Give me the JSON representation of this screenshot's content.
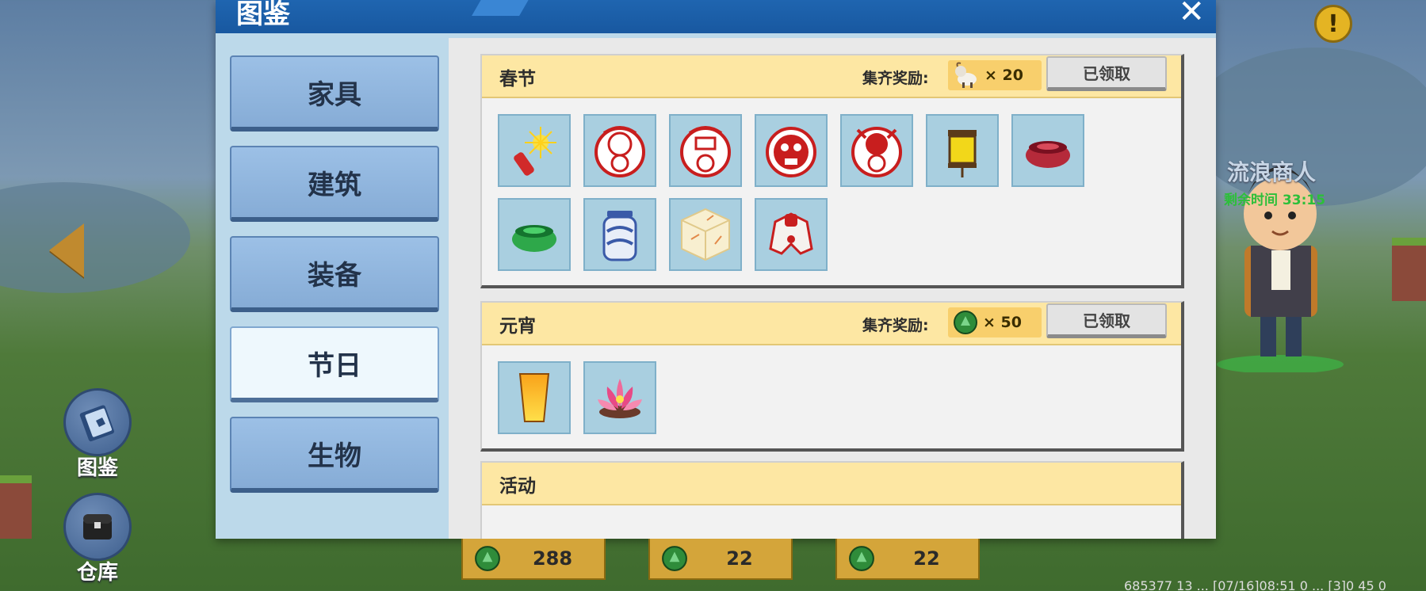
{
  "window": {
    "title": "图鉴",
    "close_label": "✕"
  },
  "categories": [
    {
      "label": "家具",
      "active": false
    },
    {
      "label": "建筑",
      "active": false
    },
    {
      "label": "装备",
      "active": false
    },
    {
      "label": "节日",
      "active": true
    },
    {
      "label": "生物",
      "active": false
    }
  ],
  "groups": [
    {
      "title": "春节",
      "reward_label": "集齐奖励:",
      "reward_icon": "goat-icon",
      "reward_amount": "× 20",
      "claim_label": "已领取",
      "items": [
        "firecracker-icon",
        "paper-cut-doll-fu-icon",
        "paper-cut-doll-lu-icon",
        "paper-cut-doll-shou-icon",
        "paper-cut-doll-xi-icon",
        "lantern-icon",
        "red-bowl-icon",
        "green-bowl-icon",
        "blue-vase-icon",
        "marble-cube-icon",
        "red-robe-icon"
      ]
    },
    {
      "title": "元宵",
      "reward_label": "集齐奖励:",
      "reward_icon": "green-gem-icon",
      "reward_amount": "× 50",
      "claim_label": "已领取",
      "items": [
        "sky-lantern-icon",
        "lotus-lantern-icon"
      ]
    },
    {
      "title": "活动"
    }
  ],
  "hud": {
    "left_buttons": [
      {
        "label": "图鉴",
        "icon": "book-icon"
      },
      {
        "label": "仓库",
        "icon": "chest-icon"
      }
    ],
    "merchant_name": "流浪商人",
    "merchant_timer": "剩余时间 33:15",
    "currencies": [
      {
        "icon": "green-gem-icon",
        "value": "288"
      },
      {
        "icon": "green-gem-icon",
        "value": "22"
      },
      {
        "icon": "green-gem-icon",
        "value": "22"
      }
    ],
    "coords_text": "685377 13 ... [07/16]08:51 0 ... [3]0 45 0"
  }
}
